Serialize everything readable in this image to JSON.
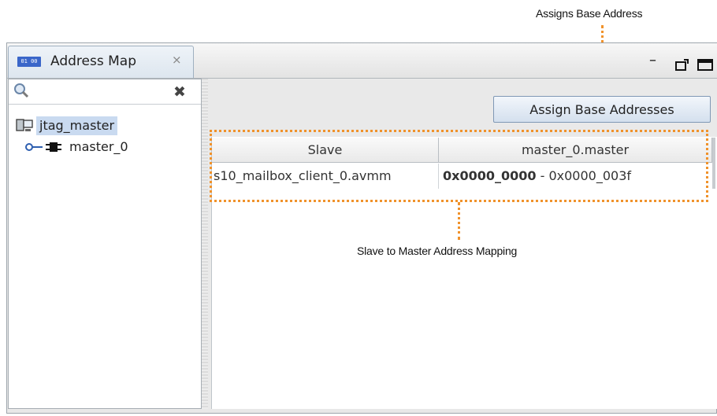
{
  "annotations": {
    "top_callout": "Assigns Base Address",
    "mid_callout": "Slave to Master Address Mapping"
  },
  "window": {
    "tab_label": "Address Map",
    "tab_icon_text": "01 00",
    "tab_close": "⨯",
    "minimize": "–",
    "restore": "❐",
    "maximize": "▭"
  },
  "left_panel": {
    "search_placeholder": "",
    "clear_glyph": "✖",
    "tree": {
      "root": "jtag_master",
      "child": "master_0"
    }
  },
  "right_panel": {
    "assign_button": "Assign Base Addresses",
    "table": {
      "headers": [
        "Slave",
        "master_0.master"
      ],
      "rows": [
        {
          "slave": "s10_mailbox_client_0.avmm",
          "base": "0x0000_0000",
          "separator": " - ",
          "end": "0x0000_003f"
        }
      ]
    }
  },
  "colors": {
    "annotation": "#f0922b",
    "selection": "#c9daf0",
    "tab_icon": "#3a66c9"
  },
  "icons": [
    "search-icon",
    "clear-icon",
    "computer-icon",
    "connection-icon",
    "component-icon"
  ]
}
